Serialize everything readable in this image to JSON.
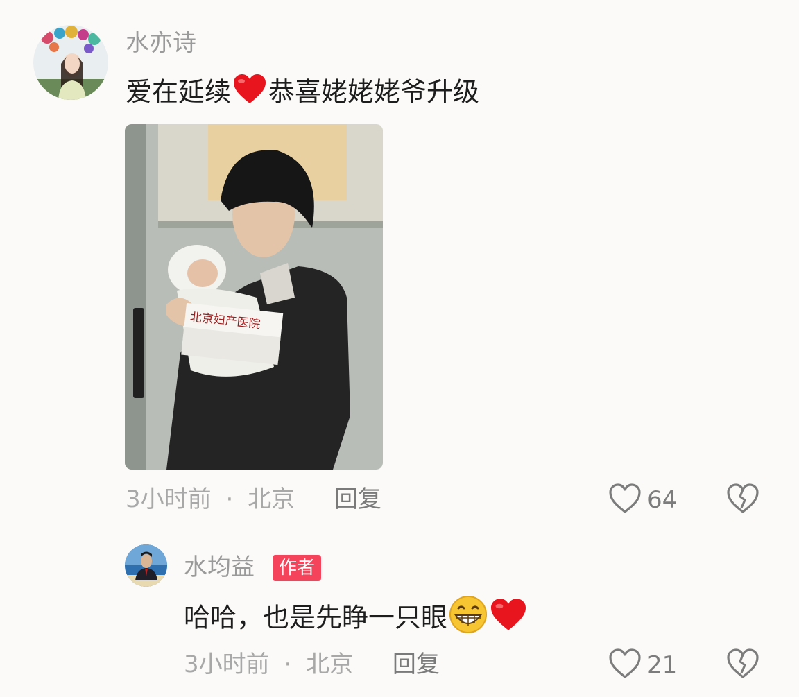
{
  "comments": [
    {
      "username": "水亦诗",
      "text_before": "爱在延续",
      "text_after": "恭喜姥姥姥爷升级",
      "photo_caption": "北京妇产医院",
      "time": "3小时前",
      "sep": "·",
      "location": "北京",
      "reply_label": "回复",
      "like_count": "64"
    },
    {
      "username": "水均益",
      "badge": "作者",
      "text": "哈哈，也是先睁一只眼",
      "time": "3小时前",
      "sep": "·",
      "location": "北京",
      "reply_label": "回复",
      "like_count": "21"
    }
  ],
  "icons": {
    "like": "heart-outline-icon",
    "dislike": "broken-heart-icon",
    "emoji_heart": "red-heart-emoji",
    "emoji_grin": "grinning-face-emoji"
  },
  "colors": {
    "background": "#fbfaf8",
    "badge": "#f4435a",
    "heart": "#e8141e"
  }
}
